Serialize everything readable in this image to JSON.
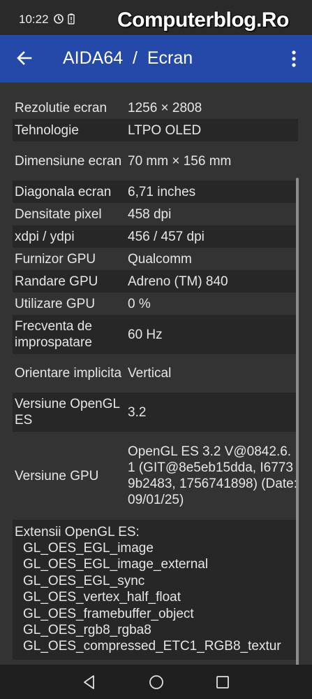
{
  "status_bar": {
    "time": "10:22",
    "watermark": "Computerblog.Ro",
    "icons": [
      "sync-icon",
      "battery-alert-icon"
    ]
  },
  "app_bar": {
    "title": "AIDA64  /  Ecran",
    "icons": [
      "back-arrow-icon",
      "more-vert-icon"
    ],
    "color": "#2449a8"
  },
  "rows": [
    {
      "key": "Rezolutie ecran",
      "value": "1256 × 2808"
    },
    {
      "key": "Tehnologie",
      "value": "LTPO OLED"
    },
    {
      "key": "Dimensiune ecran",
      "value": "70 mm × 156 mm"
    },
    {
      "key": "Diagonala ecran",
      "value": "6,71 inches"
    },
    {
      "key": "Densitate pixel",
      "value": "458 dpi"
    },
    {
      "key": "xdpi / ydpi",
      "value": "456 / 457 dpi"
    },
    {
      "key": "Furnizor GPU",
      "value": "Qualcomm"
    },
    {
      "key": "Randare GPU",
      "value": "Adreno (TM) 840"
    },
    {
      "key": "Utilizare GPU",
      "value": "0 %"
    },
    {
      "key": "Frecventa de improspatare",
      "value": "60 Hz"
    },
    {
      "key": "Orientare implicita",
      "value": "Vertical"
    },
    {
      "key": "Versiune OpenGL ES",
      "value": "3.2"
    },
    {
      "key": "Versiune GPU",
      "value": "OpenGL ES 3.2 V@0842.6.1 (GIT@8e5eb15dda, I67739b2483, 1756741898) (Date:09/01/25)"
    }
  ],
  "extensions": {
    "label": "Extensii OpenGL ES:",
    "items": [
      "GL_OES_EGL_image",
      "GL_OES_EGL_image_external",
      "GL_OES_EGL_sync",
      "GL_OES_vertex_half_float",
      "GL_OES_framebuffer_object",
      "GL_OES_rgb8_rgba8",
      "GL_OES_compressed_ETC1_RGB8_textur"
    ]
  },
  "nav_bar": {
    "icons": [
      "back-triangle-icon",
      "home-circle-icon",
      "recents-square-icon"
    ]
  }
}
